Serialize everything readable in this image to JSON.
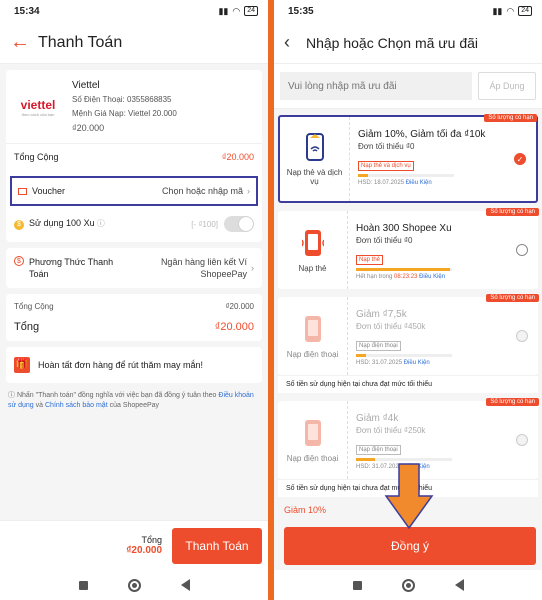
{
  "left": {
    "status": {
      "time": "15:34",
      "battery": "24"
    },
    "header": {
      "title": "Thanh Toán"
    },
    "product": {
      "logo": "viettel",
      "logo_tagline": "theo cách của bạn",
      "name": "Viettel",
      "phone": "Số Điện Thoại: 0355868835",
      "denomination": "Mệnh Giá Nạp: Viettel 20.000",
      "price": "₫20.000"
    },
    "total_label": "Tổng Cộng",
    "total_value": "₫20.000",
    "voucher": {
      "label": "Voucher",
      "value": "Chọn hoặc nhập mã"
    },
    "coins": {
      "label": "Sử dụng 100 Xu",
      "value": "[- ₫100]"
    },
    "payment": {
      "label": "Phương Thức Thanh Toán",
      "value": "Ngân hàng liên kết Ví ShopeePay"
    },
    "summary": {
      "subtotal_label": "Tổng Cộng",
      "subtotal_value": "₫20.000",
      "total_label": "Tổng",
      "total_value": "₫20.000"
    },
    "promo": "Hoàn tất đơn hàng để rút thăm may mắn!",
    "terms": {
      "prefix": "Nhấn \"Thanh toán\" đồng nghĩa với việc bạn đã đồng ý tuân theo ",
      "link1": "Điều khoản sử dụng",
      "mid": " và ",
      "link2": "Chính sách bảo mật",
      "suffix": " của ShopeePay"
    },
    "footer": {
      "total_label": "Tổng",
      "total_value": "₫20.000",
      "pay_button": "Thanh Toán"
    }
  },
  "right": {
    "status": {
      "time": "15:35",
      "battery": "24"
    },
    "header": {
      "title": "Nhập hoặc Chọn mã ưu đãi"
    },
    "code_placeholder": "Vui lòng nhập mã ưu đãi",
    "apply_label": "Áp Dụng",
    "vouchers": [
      {
        "tag": "Số lượng có hạn",
        "icon_label": "Nạp thẻ và dịch vụ",
        "title": "Giảm 10%,  Giảm tối đa ₫10k",
        "min": "Đơn tối thiểu ₫0",
        "chip": "Nạp thẻ và dịch vụ",
        "hsd": "HSD: 18.07.2025",
        "cond": "Điều Kiện",
        "progress": 0.1,
        "selected": true
      },
      {
        "tag": "Số lượng có hạn",
        "icon_label": "Nạp thẻ",
        "title": "Hoàn 300 Shopee Xu",
        "min": "Đơn tối thiểu ₫0",
        "chip": "Nạp thẻ",
        "hsd_prefix": "Hết hạn trong ",
        "hsd_time": "08:23:23",
        "cond": "Điều Kiện",
        "progress": 0.98,
        "selected": false
      },
      {
        "tag": "Số lượng có hạn",
        "icon_label": "Nạp điện thoại",
        "title": "Giảm ₫7,5k",
        "min": "Đơn tối thiểu ₫450k",
        "chip": "Nạp điện thoại",
        "hsd": "HSD: 31.07.2025",
        "cond": "Điều Kiện",
        "progress": 0.1,
        "warning": "Số tiền sử dụng hiện tại chưa đạt mức tối thiểu"
      },
      {
        "tag": "Số lượng có hạn",
        "icon_label": "Nạp điện thoại",
        "title": "Giảm ₫4k",
        "min": "Đơn tối thiểu ₫250k",
        "chip": "Nạp điện thoại",
        "hsd": "HSD: 31.07.2025",
        "cond": "Điều Kiện",
        "progress": 0.2,
        "warning": "Số tiền sử dụng hiện tại chưa đạt mức tối thiểu"
      }
    ],
    "selected_summary": "Giảm 10%",
    "confirm_button": "Đồng ý"
  },
  "colors": {
    "accent": "#ee4d2d",
    "highlight_box": "#3c3c9c",
    "annotation_arrow": "#f08a2c"
  }
}
